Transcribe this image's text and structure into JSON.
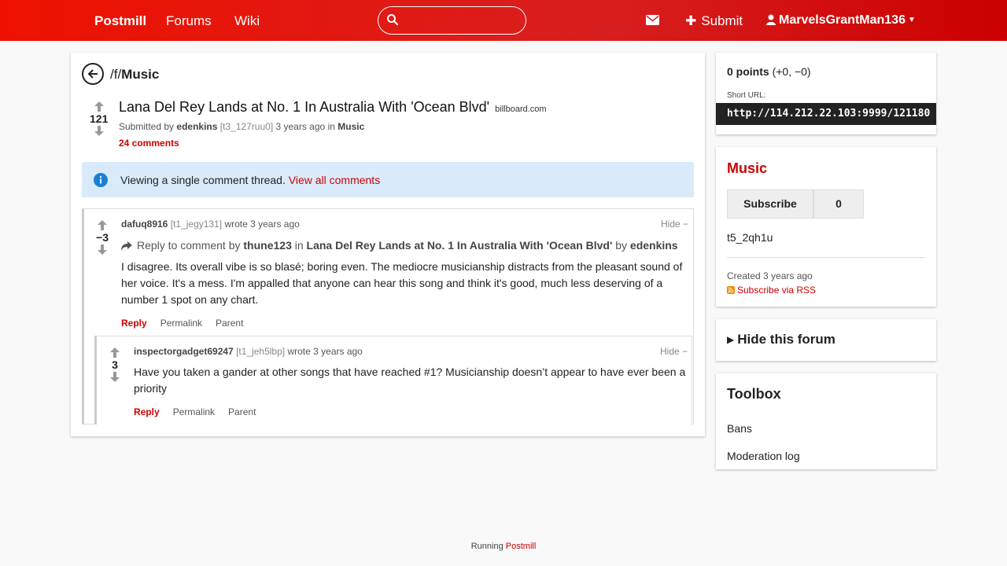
{
  "header": {
    "brand": "Postmill",
    "nav": [
      "Forums",
      "Wiki"
    ],
    "search_placeholder": "",
    "submit_label": "Submit",
    "username": "MarvelsGrantMan136"
  },
  "breadcrumb": {
    "prefix": "/f/",
    "forum": "Music"
  },
  "post": {
    "score": "121",
    "title": "Lana Del Rey Lands at No. 1 In Australia With 'Ocean Blvd'",
    "domain": "billboard.com",
    "submitted_by_label": "Submitted by",
    "author": "edenkins",
    "id": "[t3_127ruu0]",
    "time": "3 years ago",
    "in_label": "in",
    "forum": "Music",
    "comments": "24 comments"
  },
  "alert": {
    "text": "Viewing a single comment thread.",
    "link": "View all comments"
  },
  "comments": [
    {
      "score": "−3",
      "author": "dafuq8916",
      "id": "[t1_jegy131]",
      "wrote": "wrote 3 years ago",
      "hide": "Hide −",
      "reply_ctx": {
        "prefix": "Reply to comment by",
        "user": "thune123",
        "in_label": "in",
        "post": "Lana Del Rey Lands at No. 1 In Australia With 'Ocean Blvd'",
        "by_label": "by",
        "post_author": "edenkins"
      },
      "body": "I disagree. Its overall vibe is so blasé; boring even. The mediocre musicianship distracts from the pleasant sound of her voice. It's a mess. I'm appalled that anyone can hear this song and think it's good, much less deserving of a number 1 spot on any chart.",
      "actions": [
        "Reply",
        "Permalink",
        "Parent"
      ]
    },
    {
      "score": "3",
      "author": "inspectorgadget69247",
      "id": "[t1_jeh5lbp]",
      "wrote": "wrote 3 years ago",
      "hide": "Hide −",
      "body": "Have you taken a gander at other songs that have reached #1? Musicianship doesn’t appear to have ever been a priority",
      "actions": [
        "Reply",
        "Permalink",
        "Parent"
      ]
    }
  ],
  "sidebar": {
    "points": "0 points",
    "points_detail": "(+0, −0)",
    "short_url_label": "Short URL:",
    "short_url": "http://114.212.22.103:9999/121180",
    "forum_name": "Music",
    "subscribe_label": "Subscribe",
    "subscriber_count": "0",
    "forum_id": "t5_2qh1u",
    "created": "Created 3 years ago",
    "rss": "Subscribe via RSS",
    "hide_forum": "Hide this forum",
    "toolbox_title": "Toolbox",
    "toolbox_links": [
      "Bans",
      "Moderation log"
    ]
  },
  "footer": {
    "prefix": "Running",
    "link": "Postmill"
  },
  "colors": {
    "accent": "#cc0000",
    "topbar": "#e60f00",
    "alert_bg": "#d9ebfb"
  }
}
